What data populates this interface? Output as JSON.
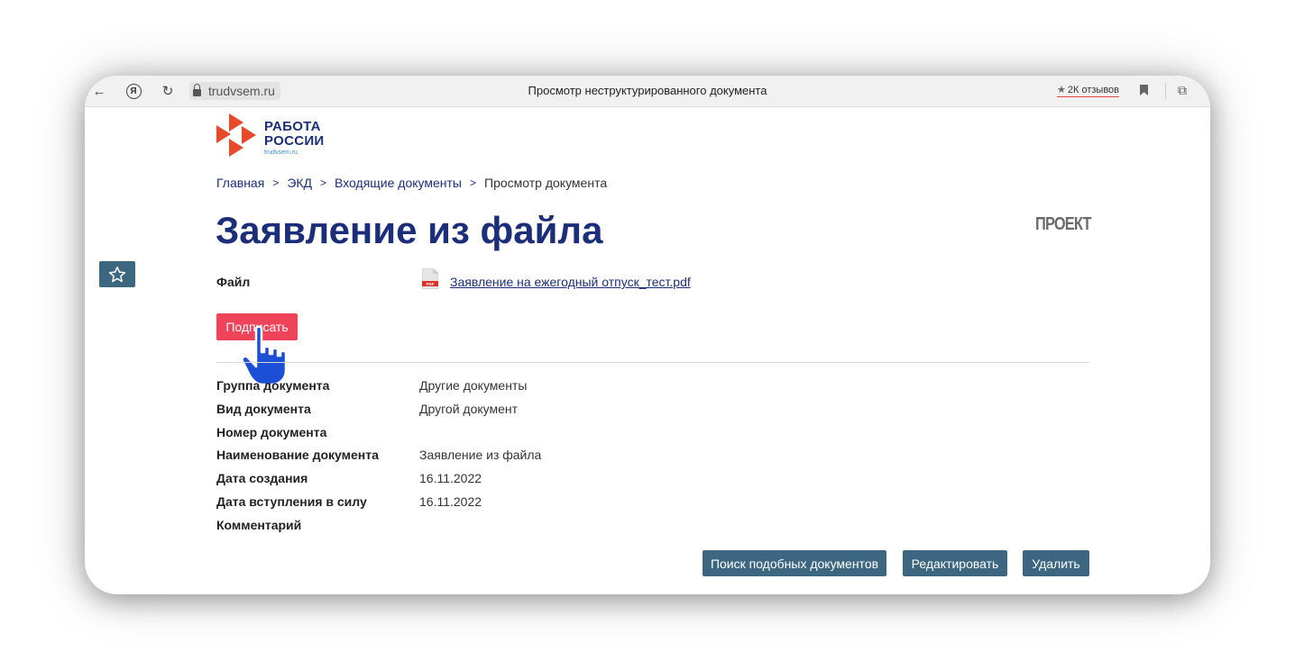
{
  "browser": {
    "url": "trudvsem.ru",
    "tab_title": "Просмотр неструктурированного документа",
    "reviews": "2К отзывов"
  },
  "logo": {
    "line1": "РАБОТА",
    "line2": "РОССИИ",
    "sub": "trudvsem.ru",
    "colors": {
      "primary": "#1c2e7a",
      "accent": "#e8492a"
    }
  },
  "breadcrumb": {
    "items": [
      "Главная",
      "ЭКД",
      "Входящие документы"
    ],
    "current": "Просмотр документа"
  },
  "page": {
    "title": "Заявление из файла",
    "stamp": "ПРОЕКТ"
  },
  "file": {
    "label": "Файл",
    "name": "Заявление на ежегодный отпуск_тест.pdf",
    "icon": "pdf-file-icon"
  },
  "actions": {
    "sign": "Подписать",
    "search_similar": "Поиск подобных документов",
    "edit": "Редактировать",
    "delete": "Удалить"
  },
  "properties": [
    {
      "label": "Группа документа",
      "value": "Другие документы"
    },
    {
      "label": "Вид документа",
      "value": "Другой документ"
    },
    {
      "label": "Номер документа",
      "value": ""
    },
    {
      "label": "Наименование документа",
      "value": "Заявление из файла"
    },
    {
      "label": "Дата создания",
      "value": "16.11.2022"
    },
    {
      "label": "Дата вступления в силу",
      "value": "16.11.2022"
    },
    {
      "label": "Комментарий",
      "value": ""
    }
  ],
  "colors": {
    "button": "#3d6781",
    "sign_button": "#ef4359",
    "title": "#1c2e7a"
  }
}
